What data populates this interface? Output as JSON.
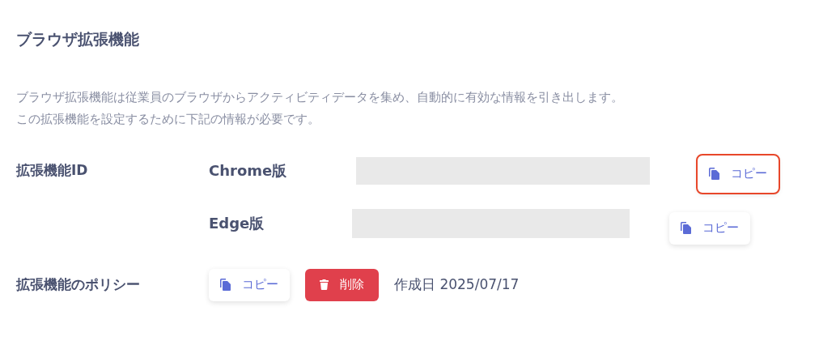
{
  "title": "ブラウザ拡張機能",
  "description": [
    "ブラウザ拡張機能は従業員のブラウザからアクティビティデータを集め、自動的に有効な情報を引き出します。",
    "この拡張機能を設定するために下記の情報が必要です。"
  ],
  "extension_id": {
    "label": "拡張機能ID",
    "versions": [
      {
        "label": "Chrome版",
        "copy_button": "コピー",
        "highlighted": true
      },
      {
        "label": "Edge版",
        "copy_button": "コピー",
        "highlighted": false
      }
    ]
  },
  "policy": {
    "label": "拡張機能のポリシー",
    "copy_button": "コピー",
    "delete_button": "削除",
    "created": "作成日 2025/07/17"
  }
}
